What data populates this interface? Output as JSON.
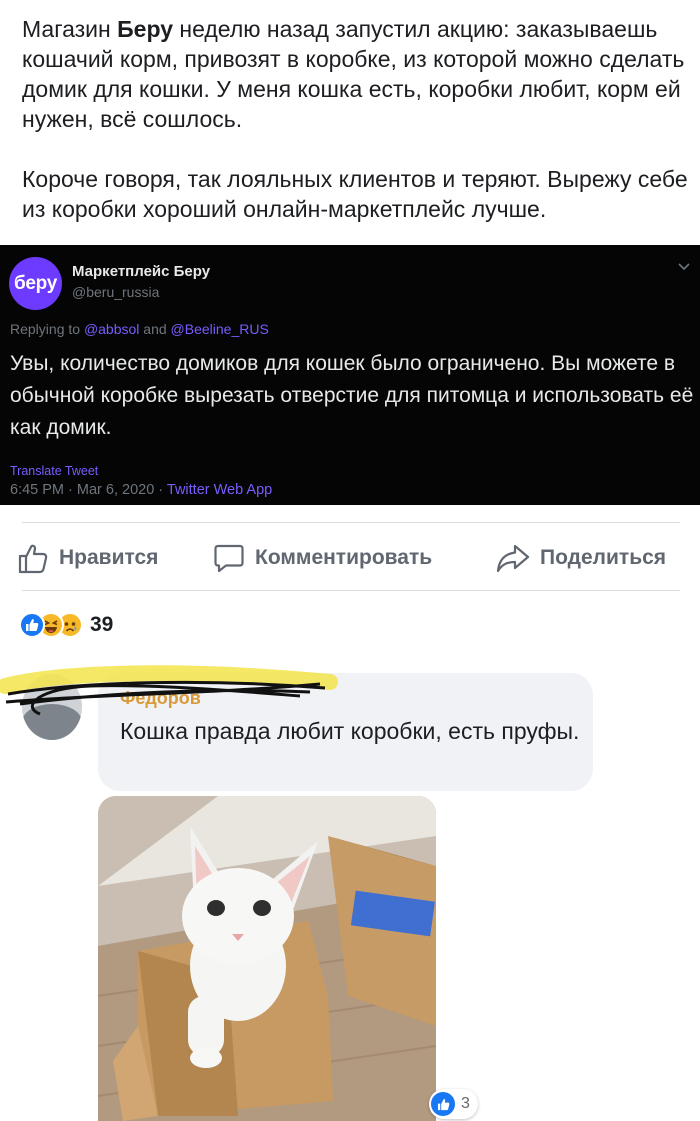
{
  "post": {
    "paragraphs": [
      {
        "before": "Магазин ",
        "bold": "Беру",
        "after": " неделю назад запустил акцию: заказываешь кошачий корм, привозят в коробке, из которой можно сделать домик для кошки. У меня кошка есть, коробки любит, корм ей нужен, всё сошлось."
      },
      {
        "text": "Короче говоря, так лояльных клиентов и теряют. Вырежу себе из коробки хороший онлайн-маркетплейс лучше."
      }
    ]
  },
  "tweet": {
    "avatar_text": "беру",
    "display_name": "Маркетплейс Беру",
    "handle": "@beru_russia",
    "replying_prefix": "Replying to ",
    "mention_1": "@abbsol",
    "replying_and": " and ",
    "mention_2": "@Beeline_RUS",
    "body": "Увы, количество домиков для кошек было ограничено.  Вы можете в обычной коробке вырезать отверстие для питомца и использовать её как домик.",
    "translate_label": "Translate Tweet",
    "timestamp": "6:45 PM · Mar 6, 2020 · ",
    "app": "Twitter Web App",
    "brand_color": "#6c3bff"
  },
  "actions": {
    "like_label": "Нравится",
    "comment_label": "Комментировать",
    "share_label": "Поделиться"
  },
  "reactions": {
    "types": [
      "like",
      "haha",
      "sad"
    ],
    "count": "39"
  },
  "comment": {
    "author_visible": "Федоров",
    "text": "Кошка правда любит коробки, есть пруфы.",
    "image_alt": "white cat sitting in a cardboard box",
    "likes": "3"
  }
}
